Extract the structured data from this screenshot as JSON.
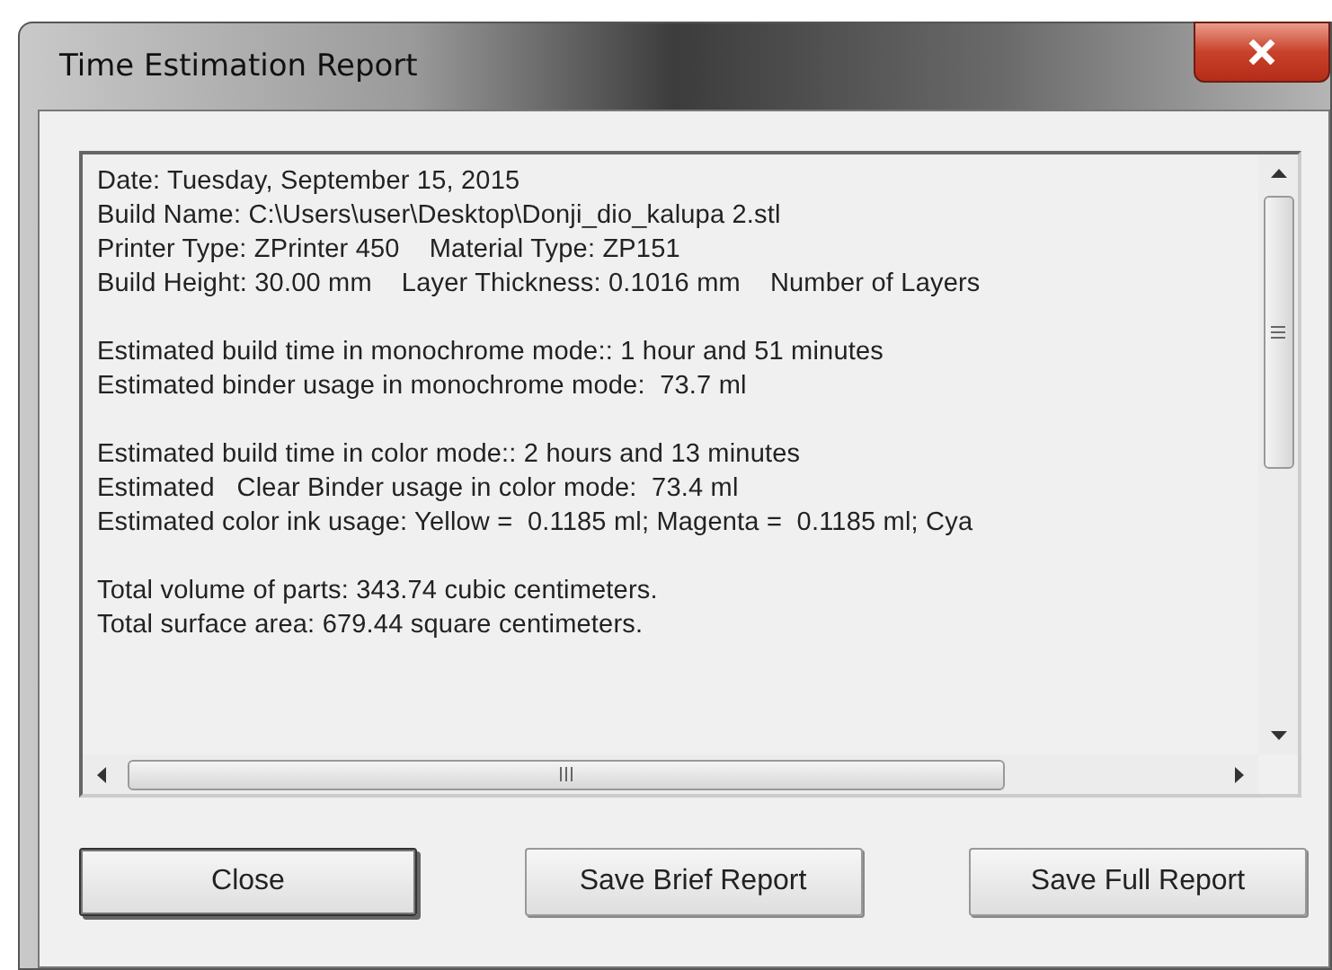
{
  "window": {
    "title": "Time Estimation Report"
  },
  "report": {
    "sections": [
      [
        "Date: Tuesday, September 15, 2015",
        "Build Name: C:\\Users\\user\\Desktop\\Donji_dio_kalupa 2.stl",
        "Printer Type: ZPrinter 450    Material Type: ZP151",
        "Build Height: 30.00 mm    Layer Thickness: 0.1016 mm    Number of Layers"
      ],
      [
        "Estimated build time in monochrome mode:: 1 hour and 51 minutes",
        "Estimated binder usage in monochrome mode:  73.7 ml"
      ],
      [
        "Estimated build time in color mode:: 2 hours and 13 minutes",
        "Estimated   Clear Binder usage in color mode:  73.4 ml",
        "Estimated color ink usage: Yellow =  0.1185 ml; Magenta =  0.1185 ml; Cya"
      ],
      [
        "Total volume of parts: 343.74 cubic centimeters.",
        "Total surface area: 679.44 square centimeters."
      ]
    ]
  },
  "buttons": [
    {
      "label": "Close",
      "default": true
    },
    {
      "label": "Save Brief Report",
      "default": false
    },
    {
      "label": "Save Full Report",
      "default": false
    }
  ]
}
